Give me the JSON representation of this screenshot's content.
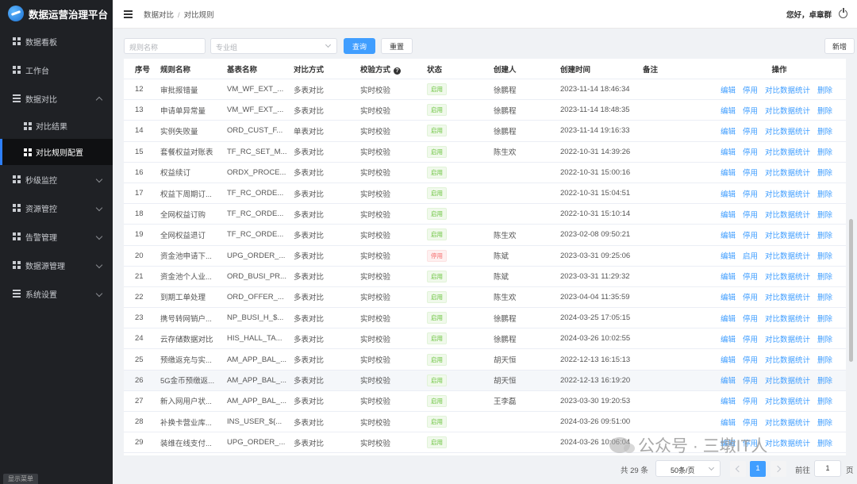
{
  "app": {
    "title": "数据运营治理平台"
  },
  "sidebar": {
    "items": [
      {
        "label": "数据看板"
      },
      {
        "label": "工作台"
      },
      {
        "label": "数据对比"
      },
      {
        "label": "秒级监控"
      },
      {
        "label": "资源管控"
      },
      {
        "label": "告警管理"
      },
      {
        "label": "数据源管理"
      },
      {
        "label": "系统设置"
      }
    ],
    "sub_items": [
      {
        "label": "对比结果"
      },
      {
        "label": "对比规则配置"
      }
    ],
    "footer": "显示菜单"
  },
  "header": {
    "breadcrumb": [
      "数据对比",
      "对比规则"
    ],
    "greeting": "您好，卓章群"
  },
  "filter": {
    "rule_name_placeholder": "规则名称",
    "group_placeholder": "专业组",
    "query_label": "查询",
    "reset_label": "重置",
    "add_label": "新增"
  },
  "table": {
    "headers": {
      "no": "序号",
      "name": "规则名称",
      "table": "基表名称",
      "way": "对比方式",
      "check": "校验方式",
      "status": "状态",
      "creator": "创建人",
      "time": "创建时间",
      "note": "备注",
      "ops": "操作"
    },
    "ops": {
      "edit": "编辑",
      "disable": "停用",
      "enable": "启用",
      "stats": "对比数据统计",
      "delete": "删除"
    },
    "rows": [
      {
        "no": "12",
        "name": "审批报错量",
        "table": "VM_WF_EXT_...",
        "way": "多表对比",
        "check": "实时校验",
        "status": "启用",
        "creator": "徐鹏程",
        "time": "2023-11-14 18:46:34",
        "note": "",
        "toggle": "停用"
      },
      {
        "no": "13",
        "name": "申请单异常量",
        "table": "VM_WF_EXT_...",
        "way": "多表对比",
        "check": "实时校验",
        "status": "启用",
        "creator": "徐鹏程",
        "time": "2023-11-14 18:48:35",
        "note": "",
        "toggle": "停用"
      },
      {
        "no": "14",
        "name": "实例失败量",
        "table": "ORD_CUST_F...",
        "way": "单表对比",
        "check": "实时校验",
        "status": "启用",
        "creator": "徐鹏程",
        "time": "2023-11-14 19:16:33",
        "note": "",
        "toggle": "停用"
      },
      {
        "no": "15",
        "name": "套餐权益对账表",
        "table": "TF_RC_SET_M...",
        "way": "多表对比",
        "check": "实时校验",
        "status": "启用",
        "creator": "陈生欢",
        "time": "2022-10-31 14:39:26",
        "note": "",
        "toggle": "停用"
      },
      {
        "no": "16",
        "name": "权益续订",
        "table": "ORDX_PROCE...",
        "way": "多表对比",
        "check": "实时校验",
        "status": "启用",
        "creator": "",
        "time": "2022-10-31 15:00:16",
        "note": "",
        "toggle": "停用"
      },
      {
        "no": "17",
        "name": "权益下周期订...",
        "table": "TF_RC_ORDE...",
        "way": "多表对比",
        "check": "实时校验",
        "status": "启用",
        "creator": "",
        "time": "2022-10-31 15:04:51",
        "note": "",
        "toggle": "停用"
      },
      {
        "no": "18",
        "name": "全网权益订购",
        "table": "TF_RC_ORDE...",
        "way": "多表对比",
        "check": "实时校验",
        "status": "启用",
        "creator": "",
        "time": "2022-10-31 15:10:14",
        "note": "",
        "toggle": "停用"
      },
      {
        "no": "19",
        "name": "全网权益退订",
        "table": "TF_RC_ORDE...",
        "way": "多表对比",
        "check": "实时校验",
        "status": "启用",
        "creator": "陈生欢",
        "time": "2023-02-08 09:50:21",
        "note": "",
        "toggle": "停用"
      },
      {
        "no": "20",
        "name": "资金池申请下...",
        "table": "UPG_ORDER_...",
        "way": "多表对比",
        "check": "实时校验",
        "status": "停用",
        "creator": "陈斌",
        "time": "2023-03-31 09:25:06",
        "note": "",
        "toggle": "启用"
      },
      {
        "no": "21",
        "name": "资金池个人业...",
        "table": "ORD_BUSI_PR...",
        "way": "多表对比",
        "check": "实时校验",
        "status": "启用",
        "creator": "陈斌",
        "time": "2023-03-31 11:29:32",
        "note": "",
        "toggle": "停用"
      },
      {
        "no": "22",
        "name": "到期工单处理",
        "table": "ORD_OFFER_...",
        "way": "多表对比",
        "check": "实时校验",
        "status": "启用",
        "creator": "陈生欢",
        "time": "2023-04-04 11:35:59",
        "note": "",
        "toggle": "停用"
      },
      {
        "no": "23",
        "name": "携号转网销户...",
        "table": "NP_BUSI_H_$...",
        "way": "多表对比",
        "check": "实时校验",
        "status": "启用",
        "creator": "徐鹏程",
        "time": "2024-03-25 17:05:15",
        "note": "",
        "toggle": "停用"
      },
      {
        "no": "24",
        "name": "云存储数据对比",
        "table": "HIS_HALL_TA...",
        "way": "多表对比",
        "check": "实时校验",
        "status": "启用",
        "creator": "徐鹏程",
        "time": "2024-03-26 10:02:55",
        "note": "",
        "toggle": "停用"
      },
      {
        "no": "25",
        "name": "预缴返充与实...",
        "table": "AM_APP_BAL_...",
        "way": "多表对比",
        "check": "实时校验",
        "status": "启用",
        "creator": "胡天恒",
        "time": "2022-12-13 16:15:13",
        "note": "",
        "toggle": "停用"
      },
      {
        "no": "26",
        "name": "5G金币预缴返...",
        "table": "AM_APP_BAL_...",
        "way": "多表对比",
        "check": "实时校验",
        "status": "启用",
        "creator": "胡天恒",
        "time": "2022-12-13 16:19:20",
        "note": "",
        "toggle": "停用"
      },
      {
        "no": "27",
        "name": "新入网用户状...",
        "table": "AM_APP_BAL_...",
        "way": "多表对比",
        "check": "实时校验",
        "status": "启用",
        "creator": "王李磊",
        "time": "2023-03-30 19:20:53",
        "note": "",
        "toggle": "停用"
      },
      {
        "no": "28",
        "name": "补换卡营业库...",
        "table": "INS_USER_${...",
        "way": "多表对比",
        "check": "实时校验",
        "status": "启用",
        "creator": "",
        "time": "2024-03-26 09:51:00",
        "note": "",
        "toggle": "停用"
      },
      {
        "no": "29",
        "name": "装维在线支付...",
        "table": "UPG_ORDER_...",
        "way": "多表对比",
        "check": "实时校验",
        "status": "启用",
        "creator": "",
        "time": "2024-03-26 10:06:04",
        "note": "",
        "toggle": "停用"
      }
    ]
  },
  "pagination": {
    "total": "共 29 条",
    "page_size": "50条/页",
    "current": "1",
    "goto_label": "前往",
    "goto_value": "1",
    "unit": "页"
  },
  "watermark": "公众号 · 三墩IT人",
  "colors": {
    "primary": "#409eff",
    "sidebar": "#1f2125",
    "on_tag": "#67c23a",
    "off_tag": "#f56c6c"
  }
}
